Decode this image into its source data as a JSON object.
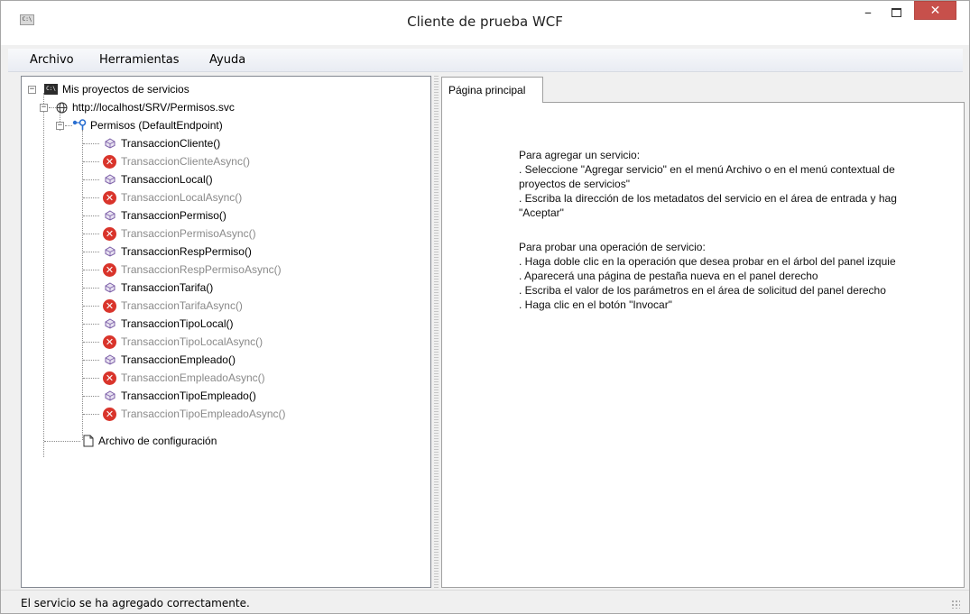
{
  "window": {
    "title": "Cliente de prueba WCF",
    "icon": "console-window-icon",
    "app_icon_text": "C:\\",
    "controls": {
      "minimize": "–",
      "maximize": "maximize-icon",
      "close": "✕"
    }
  },
  "menu": {
    "items": [
      {
        "label": "Archivo"
      },
      {
        "label": "Herramientas"
      },
      {
        "label": "Ayuda"
      }
    ]
  },
  "tree": {
    "root": {
      "label": "Mis proyectos de servicios",
      "icon": "console-icon",
      "expanded": true
    },
    "service": {
      "label": "http://localhost/SRV/Permisos.svc",
      "icon": "globe-icon",
      "expanded": true
    },
    "endpoint": {
      "label": "Permisos (DefaultEndpoint)",
      "icon": "endpoint-icon",
      "expanded": true
    },
    "operations": [
      {
        "label": "TransaccionCliente()",
        "status": "ok"
      },
      {
        "label": "TransaccionClienteAsync()",
        "status": "error"
      },
      {
        "label": "TransaccionLocal()",
        "status": "ok"
      },
      {
        "label": "TransaccionLocalAsync()",
        "status": "error"
      },
      {
        "label": "TransaccionPermiso()",
        "status": "ok"
      },
      {
        "label": "TransaccionPermisoAsync()",
        "status": "error"
      },
      {
        "label": "TransaccionRespPermiso()",
        "status": "ok"
      },
      {
        "label": "TransaccionRespPermisoAsync()",
        "status": "error"
      },
      {
        "label": "TransaccionTarifa()",
        "status": "ok"
      },
      {
        "label": "TransaccionTarifaAsync()",
        "status": "error"
      },
      {
        "label": "TransaccionTipoLocal()",
        "status": "ok"
      },
      {
        "label": "TransaccionTipoLocalAsync()",
        "status": "error"
      },
      {
        "label": "TransaccionEmpleado()",
        "status": "ok"
      },
      {
        "label": "TransaccionEmpleadoAsync()",
        "status": "error"
      },
      {
        "label": "TransaccionTipoEmpleado()",
        "status": "ok"
      },
      {
        "label": "TransaccionTipoEmpleadoAsync()",
        "status": "error"
      }
    ],
    "config": {
      "label": "Archivo de configuración",
      "icon": "file-icon"
    }
  },
  "tabs": [
    {
      "label": "Página principal",
      "active": true
    }
  ],
  "main": {
    "add_service": {
      "heading": "Para agregar un servicio:",
      "lines": [
        ". Seleccione \"Agregar servicio\" en el menú Archivo o en el menú contextual de",
        "proyectos de servicios\"",
        ". Escriba la dirección de los metadatos del servicio en el área de entrada y hag",
        "\"Aceptar\""
      ]
    },
    "test_operation": {
      "heading": "Para probar una operación de servicio:",
      "lines": [
        ". Haga doble clic en la operación que desea probar en el árbol del panel izquie",
        ". Aparecerá una página de pestaña nueva en el panel derecho",
        ". Escriba el valor de los parámetros en el área de solicitud del panel derecho",
        ". Haga clic en el botón \"Invocar\""
      ]
    }
  },
  "status": {
    "text": "El servicio se ha agregado correctamente."
  },
  "colors": {
    "close_button": "#c7504b",
    "error_icon": "#d9342b",
    "operation_icon": "#7b5ea7",
    "endpoint_icon": "#2a6fd1",
    "disabled_text": "#8a8a8a"
  }
}
